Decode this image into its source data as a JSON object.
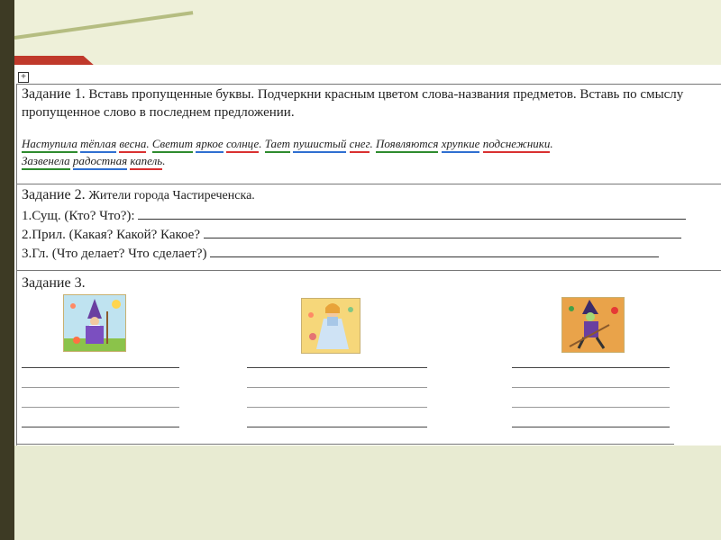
{
  "task1": {
    "heading_label": "Задание 1.",
    "heading_rest": "Вставь пропущенные буквы. Подчеркни красным цветом слова-названия предметов. Вставь по смыслу",
    "heading_line2": "пропущенное слово в последнем предложении.",
    "sentence_line1": [
      {
        "text": "Наступила",
        "underline": "green"
      },
      {
        "text": " ",
        "underline": "none"
      },
      {
        "text": "тёплая",
        "underline": "blue"
      },
      {
        "text": " ",
        "underline": "none"
      },
      {
        "text": "весна",
        "underline": "red"
      },
      {
        "text": ". ",
        "underline": "none"
      },
      {
        "text": "Светит",
        "underline": "green"
      },
      {
        "text": " ",
        "underline": "none"
      },
      {
        "text": "яркое",
        "underline": "blue"
      },
      {
        "text": " ",
        "underline": "none"
      },
      {
        "text": "солнце",
        "underline": "red"
      },
      {
        "text": ". ",
        "underline": "none"
      },
      {
        "text": "Тает",
        "underline": "green"
      },
      {
        "text": " ",
        "underline": "none"
      },
      {
        "text": "пушистый",
        "underline": "blue"
      },
      {
        "text": " ",
        "underline": "none"
      },
      {
        "text": "снег",
        "underline": "red"
      },
      {
        "text": ". ",
        "underline": "none"
      },
      {
        "text": "Появляются",
        "underline": "green"
      },
      {
        "text": " ",
        "underline": "none"
      },
      {
        "text": "хрупкие",
        "underline": "blue"
      },
      {
        "text": " ",
        "underline": "none"
      },
      {
        "text": "подснежники",
        "underline": "red"
      },
      {
        "text": ".",
        "underline": "none"
      }
    ],
    "sentence_line2": [
      {
        "text": "Зазвенела",
        "underline": "green"
      },
      {
        "text": " ",
        "underline": "none"
      },
      {
        "text": "радостная",
        "underline": "blue"
      },
      {
        "text": " ",
        "underline": "none"
      },
      {
        "text": "капель",
        "underline": "red"
      },
      {
        "text": ".",
        "underline": "none"
      }
    ]
  },
  "task2": {
    "heading_label": "Задание 2.",
    "heading_rest": "Жители города Частиреченска.",
    "line1": "1.Сущ. (Кто? Что?):",
    "line2": "2.Прил. (Какая? Какой? Какое?",
    "line3": "3.Гл. (Что делает? Что сделает?)"
  },
  "task3": {
    "heading_label": "Задание 3.",
    "pictures": [
      "wizard-picture",
      "princess-picture",
      "witch-picture"
    ]
  },
  "colors": {
    "green_underline": "#2e8b2e",
    "blue_underline": "#2f6fd0",
    "red_underline": "#d93030",
    "slide_background": "#eef0d9"
  }
}
